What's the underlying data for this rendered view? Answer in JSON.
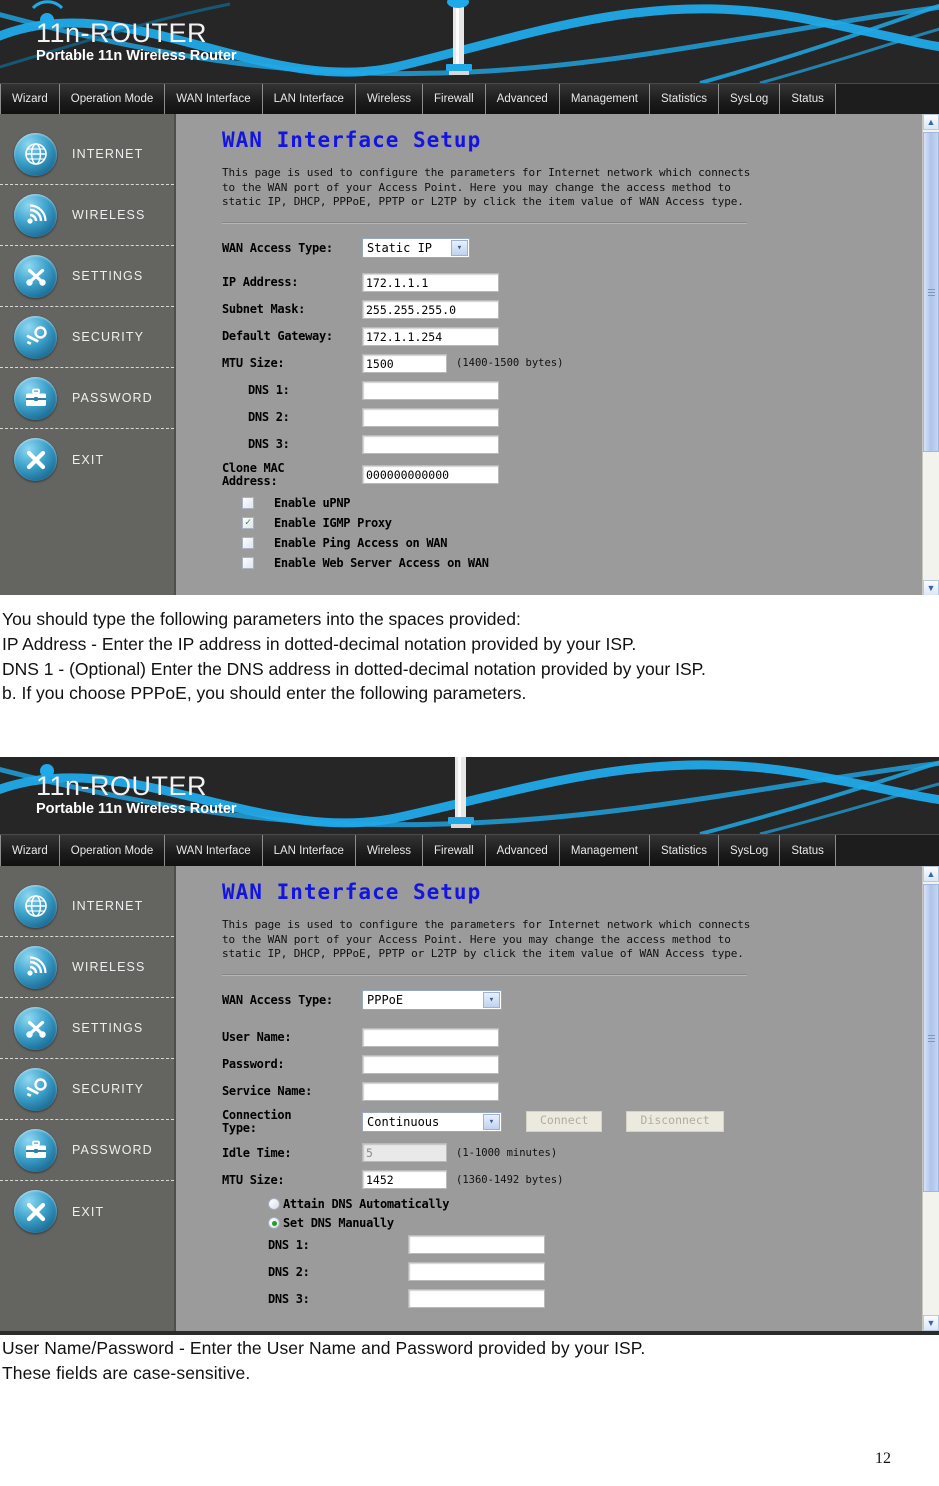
{
  "brand": {
    "logo_main": "11n-ROUTER",
    "logo_main_prefix": "11n-",
    "logo_main_suffix": "ROUTER",
    "logo_sub": "Portable 11n Wireless Router"
  },
  "nav": {
    "tabs": [
      {
        "label": "Wizard"
      },
      {
        "label": "Operation Mode"
      },
      {
        "label": "WAN Interface"
      },
      {
        "label": "LAN Interface"
      },
      {
        "label": "Wireless"
      },
      {
        "label": "Firewall"
      },
      {
        "label": "Advanced"
      },
      {
        "label": "Management"
      },
      {
        "label": "Statistics"
      },
      {
        "label": "SysLog"
      },
      {
        "label": "Status"
      }
    ]
  },
  "sidebar": {
    "items": [
      {
        "label": "INTERNET",
        "icon": "globe-icon"
      },
      {
        "label": "WIRELESS",
        "icon": "wifi-signal-icon"
      },
      {
        "label": "SETTINGS",
        "icon": "tools-icon"
      },
      {
        "label": "SECURITY",
        "icon": "key-icon"
      },
      {
        "label": "PASSWORD",
        "icon": "briefcase-icon"
      },
      {
        "label": "EXIT",
        "icon": "close-x-icon"
      }
    ]
  },
  "page": {
    "title": "WAN Interface Setup",
    "description": "This page is used to configure the parameters for Internet network which connects to the WAN port of your Access Point. Here you may change the access method to static IP, DHCP, PPPoE, PPTP or L2TP by click the item value of WAN Access type."
  },
  "static_form": {
    "access_type_label": "WAN Access Type:",
    "access_type_value": "Static IP",
    "fields": [
      {
        "label": "IP Address:",
        "value": "172.1.1.1"
      },
      {
        "label": "Subnet Mask:",
        "value": "255.255.255.0"
      },
      {
        "label": "Default Gateway:",
        "value": "172.1.1.254"
      }
    ],
    "mtu_label": "MTU Size:",
    "mtu_value": "1500",
    "mtu_hint": "(1400-1500 bytes)",
    "dns": [
      {
        "label": "DNS 1:",
        "value": ""
      },
      {
        "label": "DNS 2:",
        "value": ""
      },
      {
        "label": "DNS 3:",
        "value": ""
      }
    ],
    "clone_mac_label_line1": "Clone MAC",
    "clone_mac_label_line2": "Address:",
    "clone_mac_value": "000000000000",
    "checkboxes": [
      {
        "label": "Enable uPNP",
        "checked": false
      },
      {
        "label": "Enable IGMP Proxy",
        "checked": true
      },
      {
        "label": "Enable Ping Access on WAN",
        "checked": false
      },
      {
        "label": "Enable Web Server Access on WAN",
        "checked": false
      }
    ],
    "check_mark": "✓"
  },
  "pppoe_form": {
    "access_type_label": "WAN Access Type:",
    "access_type_value": "PPPoE",
    "fields": [
      {
        "label": "User Name:",
        "value": ""
      },
      {
        "label": "Password:",
        "value": ""
      },
      {
        "label": "Service Name:",
        "value": ""
      }
    ],
    "connection_type_label_line1": "Connection",
    "connection_type_label_line2": "Type:",
    "connection_type_value": "Continuous",
    "connect_button": "Connect",
    "disconnect_button": "Disconnect",
    "idle_label": "Idle Time:",
    "idle_value": "5",
    "idle_hint": "(1-1000 minutes)",
    "mtu_label": "MTU Size:",
    "mtu_value": "1452",
    "mtu_hint": "(1360-1492 bytes)",
    "radios": [
      {
        "label": "Attain DNS Automatically",
        "selected": false
      },
      {
        "label": "Set DNS Manually",
        "selected": true
      }
    ],
    "dns": [
      {
        "label": "DNS 1:",
        "value": ""
      },
      {
        "label": "DNS 2:",
        "value": ""
      },
      {
        "label": "DNS 3:",
        "value": ""
      }
    ]
  },
  "prose_middle": [
    "You should type the following parameters into the spaces provided:",
    "IP Address - Enter the IP address in dotted-decimal notation provided by your ISP.",
    "DNS 1 - (Optional) Enter the DNS address in dotted-decimal notation provided by your ISP.",
    "b. If you choose PPPoE, you should enter the following parameters."
  ],
  "prose_bottom": [
    "User Name/Password - Enter the User Name and Password provided by your ISP.",
    "These fields are case-sensitive."
  ],
  "page_number": "12",
  "colors": {
    "title_blue": "#1414e0",
    "accent_cyan": "#1fa9e8",
    "panel_gray": "#9b9b9b",
    "sidebar_gray": "#646461",
    "banner_dark": "#262626"
  },
  "scroll": {
    "up_arrow": "▲",
    "down_arrow": "▼"
  }
}
